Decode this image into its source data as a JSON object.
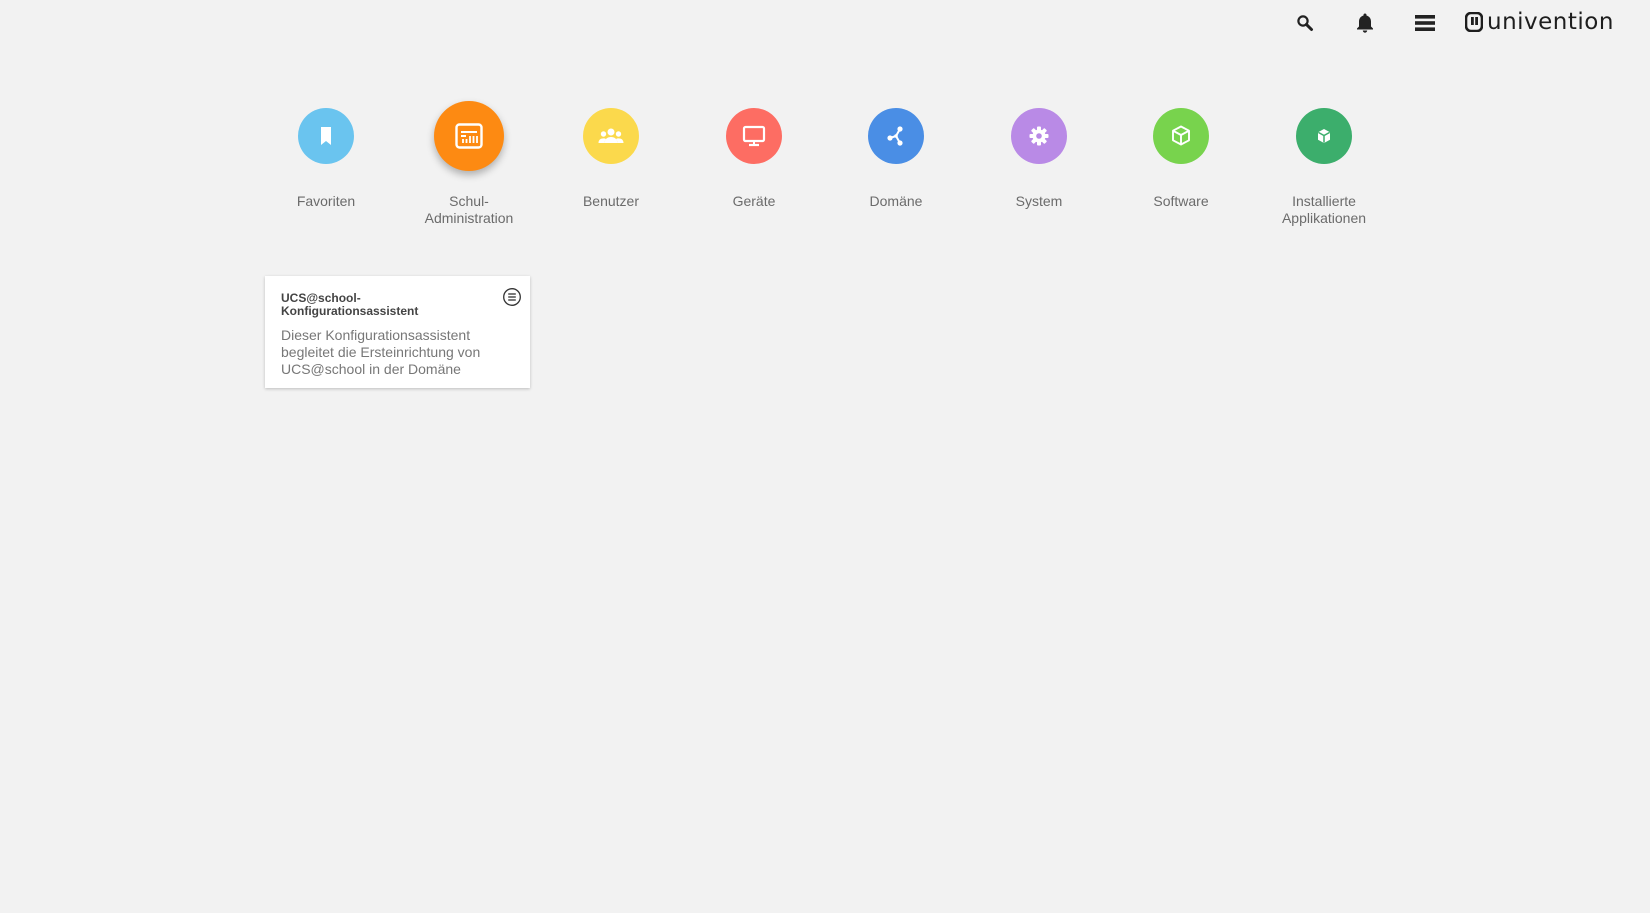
{
  "header": {
    "brand": "univention",
    "icons": [
      "search-icon",
      "bell-icon",
      "menu-icon"
    ]
  },
  "categories": [
    {
      "label": "Favoriten",
      "color": "#6ac4ef",
      "icon": "bookmark-icon"
    },
    {
      "label": "Schul-\nAdministration",
      "color": "#fd8a12",
      "icon": "school-admin-icon",
      "active": true
    },
    {
      "label": "Benutzer",
      "color": "#fbd94c",
      "icon": "users-icon"
    },
    {
      "label": "Geräte",
      "color": "#fd6d63",
      "icon": "monitor-icon"
    },
    {
      "label": "Domäne",
      "color": "#4a8ee5",
      "icon": "domain-icon"
    },
    {
      "label": "System",
      "color": "#b98ae6",
      "icon": "gear-icon"
    },
    {
      "label": "Software",
      "color": "#78d34d",
      "icon": "package-icon"
    },
    {
      "label": "Installierte\nApplikationen",
      "color": "#3cae6c",
      "icon": "box-icon"
    }
  ],
  "tile": {
    "title": "UCS@school-Konfigurationsassistent",
    "description": "Dieser Konfigurationsassistent begleitet die Ersteinrichtung von UCS@school in der Domäne",
    "menu_icon": "tile-menu-icon"
  }
}
